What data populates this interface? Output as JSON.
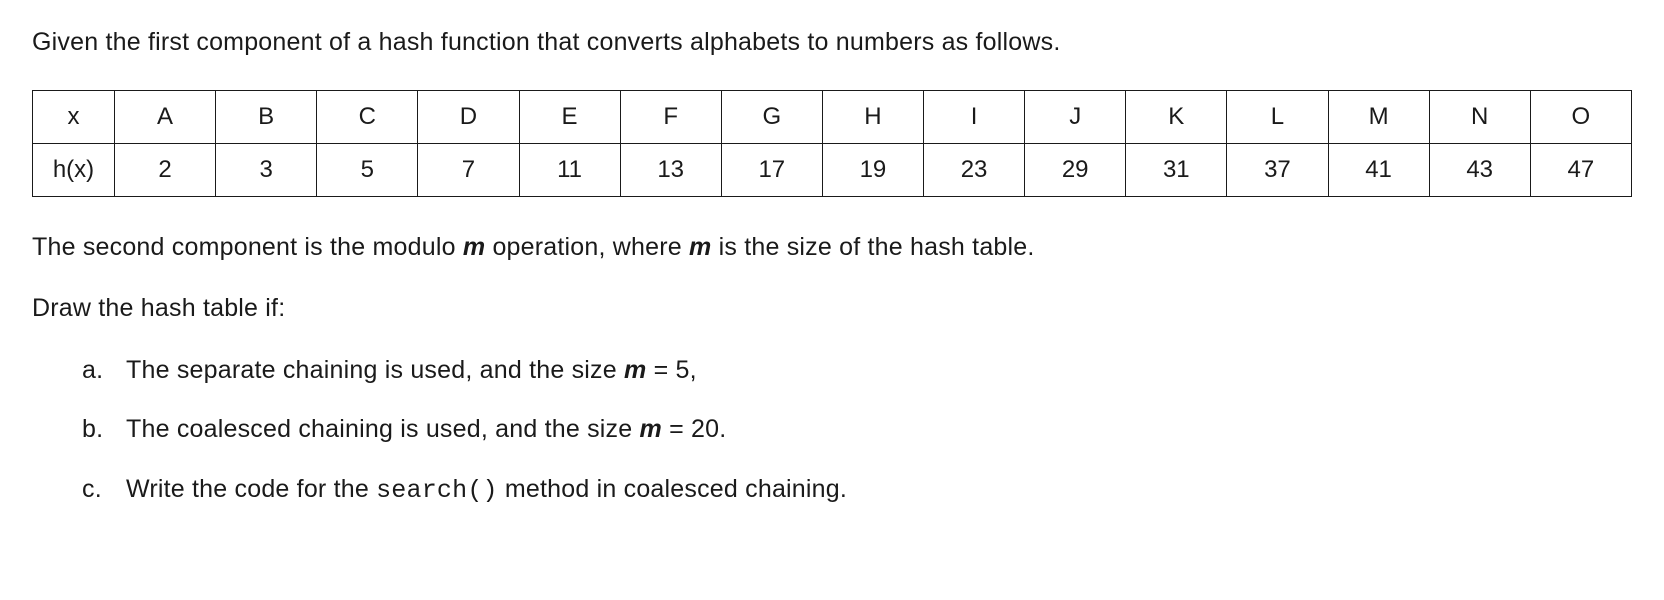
{
  "intro": "Given the first component of a hash function that converts alphabets to numbers as follows.",
  "table": {
    "row1_label": "x",
    "row2_label": "h(x)",
    "columns": [
      "A",
      "B",
      "C",
      "D",
      "E",
      "F",
      "G",
      "H",
      "I",
      "J",
      "K",
      "L",
      "M",
      "N",
      "O"
    ],
    "values": [
      "2",
      "3",
      "5",
      "7",
      "11",
      "13",
      "17",
      "19",
      "23",
      "29",
      "31",
      "37",
      "41",
      "43",
      "47"
    ]
  },
  "para2_pre": "The second component is the modulo ",
  "para2_m": "m",
  "para2_post1": " operation, where ",
  "para2_m2": "m",
  "para2_post2": " is the size of the hash table.",
  "para3": "Draw the hash table if:",
  "items": {
    "a": {
      "marker": "a.",
      "pre": "The separate chaining is used, and the size ",
      "m": "m",
      "post": " = 5,"
    },
    "b": {
      "marker": "b.",
      "pre": "The coalesced chaining is used, and the size ",
      "m": "m",
      "post": " = 20."
    },
    "c": {
      "marker": "c.",
      "pre": "Write the code for the ",
      "code": "search()",
      "post": " method in coalesced chaining."
    }
  }
}
